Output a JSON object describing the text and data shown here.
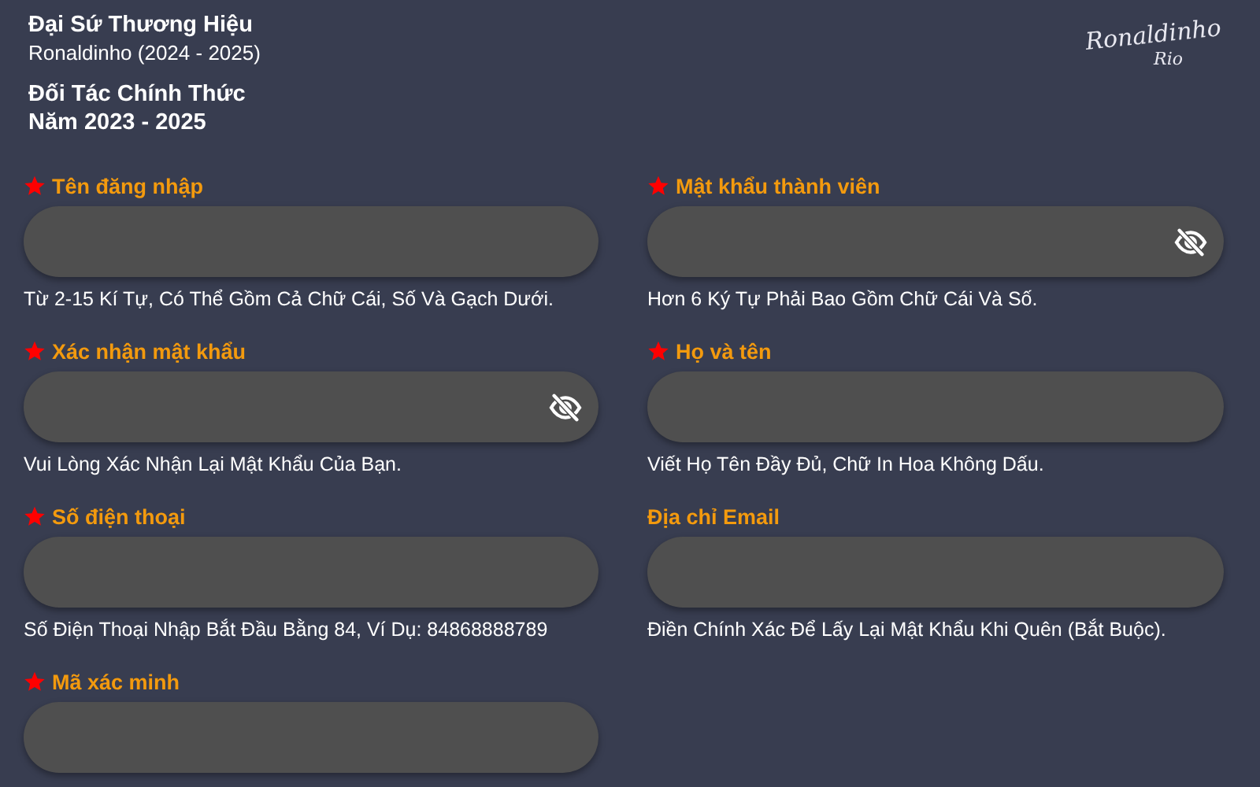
{
  "header": {
    "ambassador_title": "Đại Sứ Thương Hiệu",
    "ambassador_name": "Ronaldinho (2024 - 2025)",
    "partner_title": "Đối Tác Chính Thức",
    "partner_years": "Năm 2023 - 2025"
  },
  "signature": {
    "name": "Ronaldinho",
    "place": "Rio"
  },
  "fields": [
    {
      "label": "Tên đăng nhập",
      "required": true,
      "password_toggle": false,
      "hint": "Từ 2-15 Kí Tự, Có Thể Gồm Cả Chữ Cái, Số Và Gạch Dưới."
    },
    {
      "label": "Mật khẩu thành viên",
      "required": true,
      "password_toggle": true,
      "hint": "Hơn 6 Ký Tự Phải Bao Gồm Chữ Cái Và Số."
    },
    {
      "label": "Xác nhận mật khẩu",
      "required": true,
      "password_toggle": true,
      "hint": "Vui Lòng Xác Nhận Lại Mật Khẩu Của Bạn."
    },
    {
      "label": "Họ và tên",
      "required": true,
      "password_toggle": false,
      "hint": "Viết Họ Tên Đầy Đủ, Chữ In Hoa Không Dấu."
    },
    {
      "label": "Số điện thoại",
      "required": true,
      "password_toggle": false,
      "hint": "Số Điện Thoại Nhập Bắt Đầu Bằng 84, Ví Dụ: 84868888789"
    },
    {
      "label": "Địa chỉ Email",
      "required": false,
      "password_toggle": false,
      "hint": "Điền Chính Xác Để Lấy Lại Mật Khẩu Khi Quên (Bắt Buộc)."
    },
    {
      "label": "Mã xác minh",
      "required": true,
      "password_toggle": false
    }
  ]
}
